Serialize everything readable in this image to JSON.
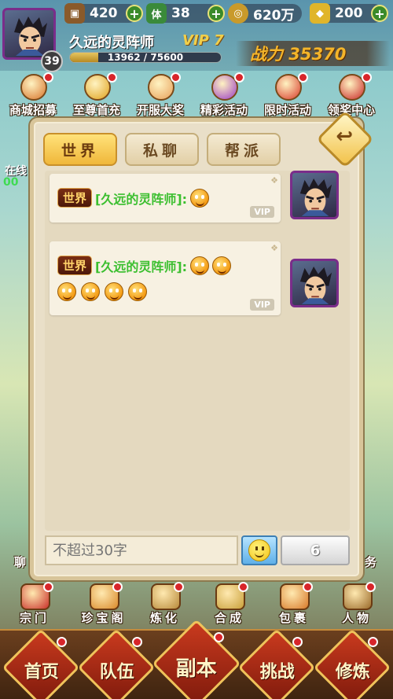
{
  "resources": {
    "food": "420",
    "stamina": "38",
    "coins": "620万",
    "gold": "200",
    "stamina_icon_text": "体"
  },
  "player": {
    "name": "久远的灵阵师",
    "vip": "VIP 7",
    "level": "39",
    "exp_text": "13962 / 75600",
    "exp_fraction": 0.185,
    "power": "战力 35370"
  },
  "activities": [
    {
      "label": "商城招募",
      "icon": "recruit-icon",
      "color": "#d8732a"
    },
    {
      "label": "至尊首充",
      "icon": "treasure-chest-icon",
      "color": "#e0a21c"
    },
    {
      "label": "开服大奖",
      "icon": "bear-mascot-icon",
      "color": "#e8a05a"
    },
    {
      "label": "精彩活动",
      "icon": "gift-icon",
      "color": "#9a3bc4"
    },
    {
      "label": "限时活动",
      "icon": "clock-icon",
      "color": "#d83a2a"
    },
    {
      "label": "领奖中心",
      "icon": "prize-icon",
      "color": "#c92828",
      "badge": "奖"
    }
  ],
  "side": {
    "online_label": "在线",
    "online_time": "00",
    "left_label": "聊",
    "right_label": "务"
  },
  "chat": {
    "tabs": [
      {
        "label": "世界",
        "active": true
      },
      {
        "label": "私聊",
        "active": false
      },
      {
        "label": "帮派",
        "active": false
      }
    ],
    "back_glyph": "↩",
    "messages": [
      {
        "channel": "世界",
        "sender": "[久远的灵阵师]:",
        "emotes_line1": 1,
        "emotes_line2": 0,
        "vip": "VIP"
      },
      {
        "channel": "世界",
        "sender": "[久远的灵阵师]:",
        "emotes_line1": 2,
        "emotes_line2": 4,
        "vip": "VIP"
      }
    ],
    "input_placeholder": "不超过30字",
    "send_label": "6"
  },
  "bottom_icons": [
    {
      "label": "宗门",
      "icon": "sect-icon",
      "color": "#c9302a"
    },
    {
      "label": "珍宝阁",
      "icon": "treasure-pavilion-icon",
      "color": "#d98a2a"
    },
    {
      "label": "炼化",
      "icon": "furnace-icon",
      "color": "#b88a3a"
    },
    {
      "label": "合成",
      "icon": "compose-icon",
      "color": "#c9a03a"
    },
    {
      "label": "包裹",
      "icon": "bag-icon",
      "color": "#d87a2a"
    },
    {
      "label": "人物",
      "icon": "character-icon",
      "color": "#9a6a2a"
    }
  ],
  "nav": [
    {
      "label": "首页",
      "name": "nav-home"
    },
    {
      "label": "队伍",
      "name": "nav-team"
    },
    {
      "label": "副本",
      "name": "nav-dungeon"
    },
    {
      "label": "挑战",
      "name": "nav-challenge"
    },
    {
      "label": "修炼",
      "name": "nav-cultivate"
    }
  ]
}
